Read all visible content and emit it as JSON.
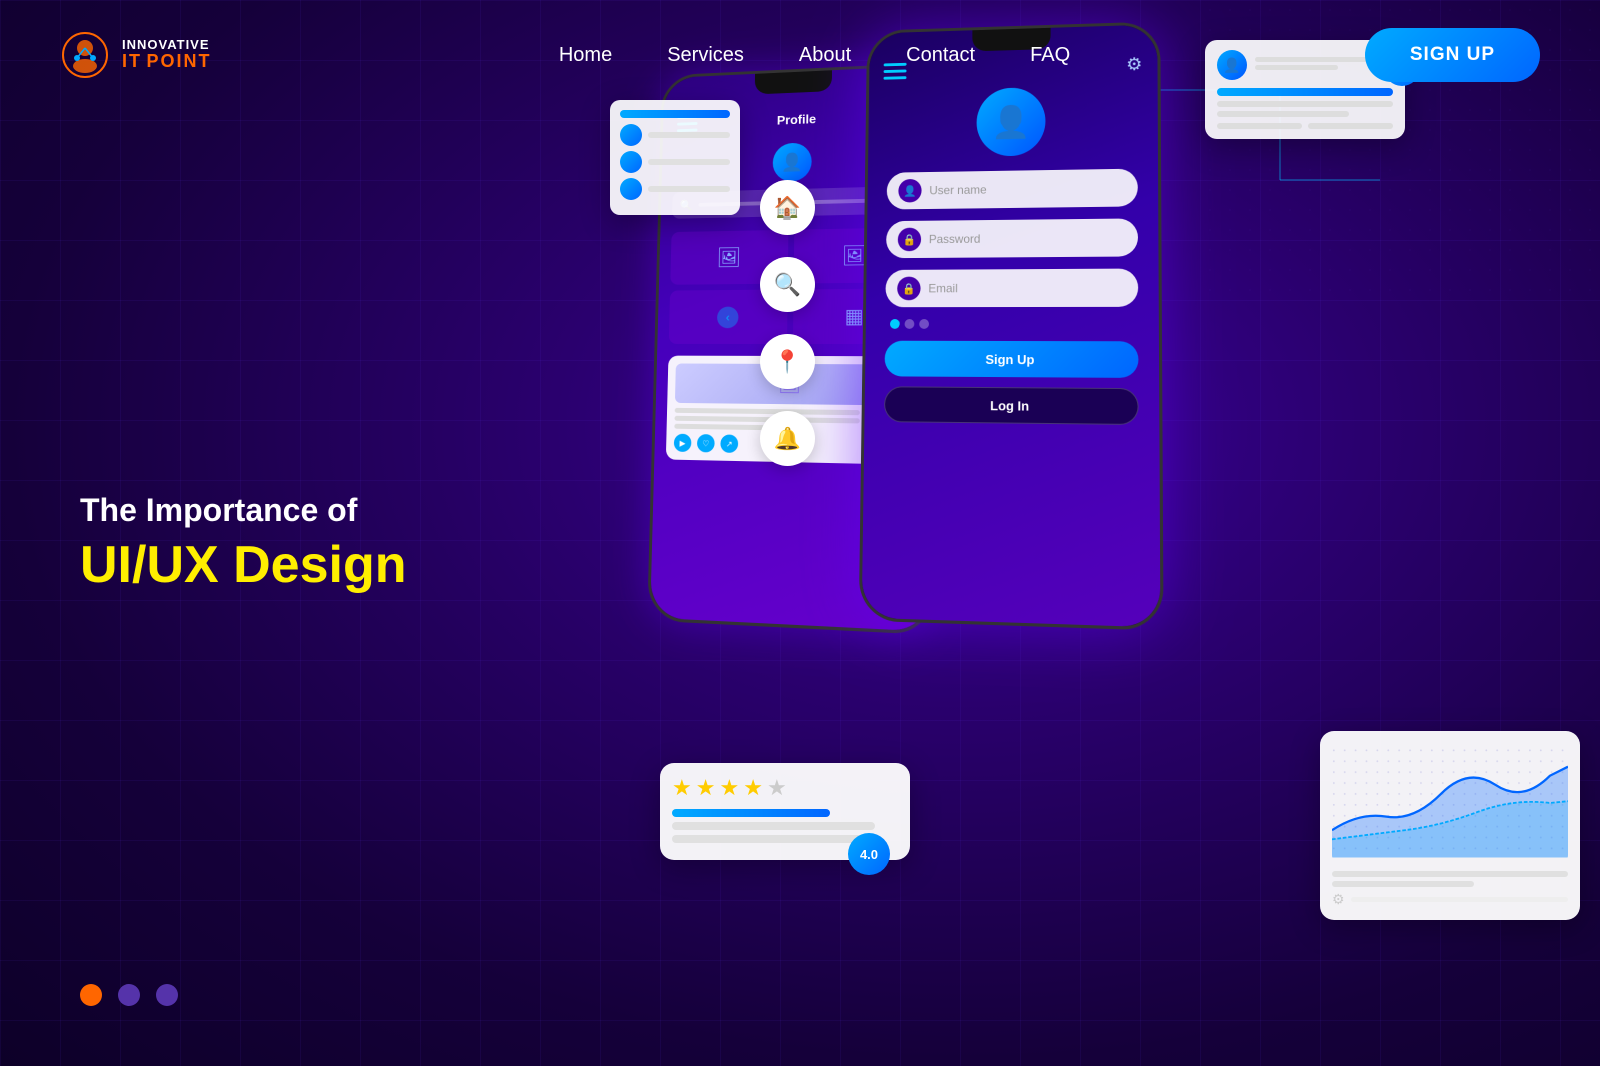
{
  "brand": {
    "name_innovative": "INNOVATIVE",
    "name_it": "IT",
    "name_point": "POINT"
  },
  "nav": {
    "links": [
      {
        "label": "Home",
        "id": "home"
      },
      {
        "label": "Services",
        "id": "services"
      },
      {
        "label": "About",
        "id": "about"
      },
      {
        "label": "Contact",
        "id": "contact"
      },
      {
        "label": "FAQ",
        "id": "faq"
      }
    ],
    "signup_label": "SIGN UP"
  },
  "hero": {
    "subtitle": "The Importance of",
    "title": "UI/UX Design"
  },
  "pagination": {
    "dots": [
      {
        "active": true
      },
      {
        "active": false
      },
      {
        "active": false
      }
    ]
  },
  "phone1": {
    "profile_label": "Profile",
    "search_placeholder": "Search"
  },
  "phone2": {
    "username_placeholder": "User name",
    "password_placeholder": "Password",
    "email_placeholder": "Email",
    "signup_btn": "Sign Up",
    "login_btn": "Log In"
  },
  "ratings": {
    "stars_filled": 4,
    "stars_empty": 1,
    "score": "4.0"
  },
  "colors": {
    "accent_blue": "#00aaff",
    "accent_yellow": "#ffee00",
    "accent_orange": "#ff6600",
    "bg_dark": "#1a0050",
    "dot_active": "#ff6600",
    "dot_inactive": "#5533aa"
  }
}
